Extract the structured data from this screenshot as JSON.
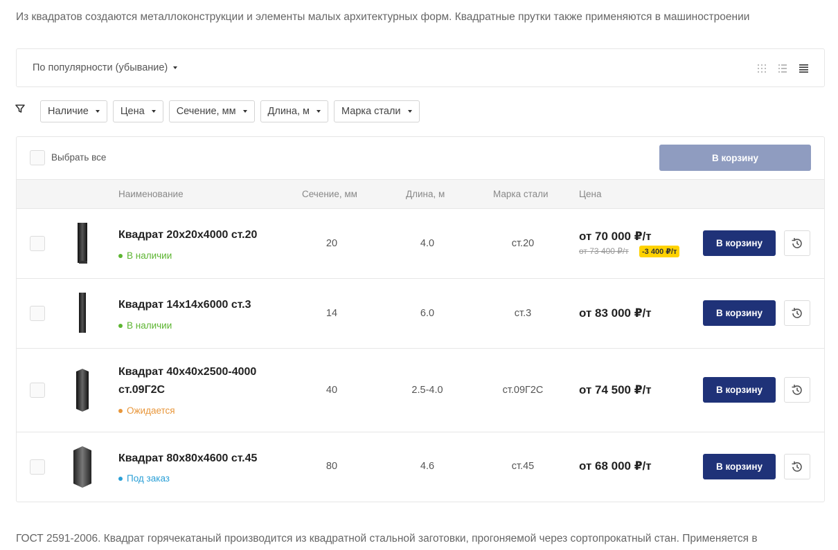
{
  "intro_text": "Из квадратов создаются металлоконструкции и элементы малых архитектурных форм. Квадратные прутки также применяются в машиностроении",
  "sort": {
    "label": "По популярности (убывание)"
  },
  "view_icons": [
    "grid-view-icon",
    "list-view-icon",
    "table-view-icon"
  ],
  "filters": [
    "Наличие",
    "Цена",
    "Сечение, мм",
    "Длина, м",
    "Марка стали"
  ],
  "select_all_label": "Выбрать все",
  "cart_all_label": "В корзину",
  "columns": {
    "name": "Наименование",
    "section": "Сечение, мм",
    "length": "Длина, м",
    "grade": "Марка стали",
    "price": "Цена"
  },
  "rows": [
    {
      "name": "Квадрат 20х20х4000 ст.20",
      "stock": "В наличии",
      "stock_color": "#5cb531",
      "section": "20",
      "length": "4.0",
      "grade": "ст.20",
      "price": "от 70 000 ₽/т",
      "old_price": "от 73 400 ₽/т",
      "discount": "-3 400 ₽/т",
      "cart_label": "В корзину"
    },
    {
      "name": "Квадрат 14х14х6000 ст.3",
      "stock": "В наличии",
      "stock_color": "#5cb531",
      "section": "14",
      "length": "6.0",
      "grade": "ст.3",
      "price": "от 83 000 ₽/т",
      "cart_label": "В корзину"
    },
    {
      "name": "Квадрат 40х40х2500-4000 ст.09Г2С",
      "stock": "Ожидается",
      "stock_color": "#e8963a",
      "section": "40",
      "length": "2.5-4.0",
      "grade": "ст.09Г2С",
      "price": "от 74 500 ₽/т",
      "cart_label": "В корзину"
    },
    {
      "name": "Квадрат 80х80х4600 ст.45",
      "stock": "Под заказ",
      "stock_color": "#2a9fd6",
      "section": "80",
      "length": "4.6",
      "grade": "ст.45",
      "price": "от 68 000 ₽/т",
      "cart_label": "В корзину"
    }
  ],
  "footer_text": "ГОСТ 2591-2006. Квадрат горячекатаный производится из квадратной стальной заготовки, прогоняемой через сортопрокатный стан. Применяется в",
  "colors": {
    "primary": "#1f3278",
    "primary_disabled": "#8f9cc0",
    "discount_badge": "#ffd200"
  }
}
